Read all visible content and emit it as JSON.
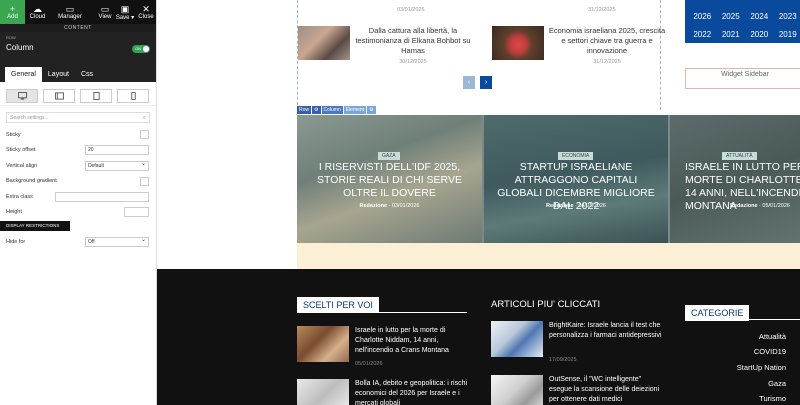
{
  "toolbar": {
    "add": "Add",
    "cloud": "Cloud",
    "manager": "Manager",
    "view": "View",
    "save": "Save ▾",
    "close": "Close"
  },
  "panel": {
    "content_label": "CONTENT",
    "crumb": "ROW",
    "title": "Column",
    "toggle": "ON",
    "tabs": [
      "General",
      "Layout",
      "Css"
    ],
    "search_placeholder": "Search settings...",
    "props": {
      "sticky": "Sticky",
      "sticky_offset": "Sticky offset",
      "sticky_offset_value": "20",
      "vertical_align": "Vertical align",
      "vertical_align_value": "Default",
      "background_gradient": "Background gradient",
      "extra_class": "Extra class",
      "height": "Height"
    },
    "display_restrictions": "DISPLAY RESTRICTIONS",
    "hide_for": "Hide for",
    "hide_for_value": "Off"
  },
  "news": {
    "top_dates": [
      "03/01/2026",
      "31/12/2025"
    ],
    "cards": [
      {
        "title": "Dalla cattura alla libertà, la testimonianza di Elkana Bohbot su Hamas",
        "date": "30/12/2025"
      },
      {
        "title": "Economia israeliana 2025, crescita e settori chiave tra guerra e innovazione",
        "date": "31/12/2025"
      }
    ],
    "pager_prev": "‹",
    "pager_next": "›"
  },
  "years": [
    "2026",
    "2025",
    "2024",
    "2023",
    "2022",
    "2021",
    "2020",
    "2019"
  ],
  "widget_sidebar": "Widget Sidebar",
  "element_toolbar": {
    "row": "Row",
    "column": "Column",
    "element": "Element"
  },
  "heroes": [
    {
      "tag": "GAZA",
      "title": "I RISERVISTI DELL'IDF 2025, STORIE REALI DI CHI SERVE OLTRE IL DOVERE",
      "author": "Redazione",
      "date": "03/01/2026"
    },
    {
      "tag": "ECONOMIA",
      "title": "STARTUP ISRAELIANE ATTRAGGONO CAPITALI GLOBALI DICEMBRE MIGLIORE DAL 2022",
      "author": "Redazione",
      "date": "04/01/2026"
    },
    {
      "tag": "ATTUALITÀ",
      "title": "ISRAELE IN LUTTO PER LA MORTE DI CHARLOTTE NIDDAM, 14 ANNI, NELL'INCENDIO A CRANS MONTANA",
      "author": "Redazione",
      "date": "05/01/2026"
    }
  ],
  "footer": {
    "scelti_title": "SCELTI PER VOI",
    "cliccati_title": "ARTICOLI PIU' CLICCATI",
    "categorie_title": "CATEGORIE",
    "scelti": [
      {
        "title": "Israele in lutto per la morte di Charlotte Niddam, 14 anni, nell'incendio a Crans Montana",
        "date": "05/01/2026"
      },
      {
        "title": "Bolla IA, debito e geopolitica: i rischi economici del 2026 per Israele e i mercati globali",
        "date": ""
      }
    ],
    "cliccati": [
      {
        "title": "BrightKaire: Israele lancia il test che personalizza i farmaci antidepressivi",
        "date": "17/09/2025"
      },
      {
        "title": "OutSense, il \"WC intelligente\" esegue la scansione delle deiezioni per ottenere dati medici",
        "date": ""
      }
    ],
    "categories": [
      "Attualità",
      "COVID19",
      "StartUp Nation",
      "Gaza",
      "Turismo"
    ]
  },
  "colors": {
    "accent_green": "#3aa64f",
    "years_blue": "#0a4a9c",
    "footer_bg": "#111111"
  }
}
